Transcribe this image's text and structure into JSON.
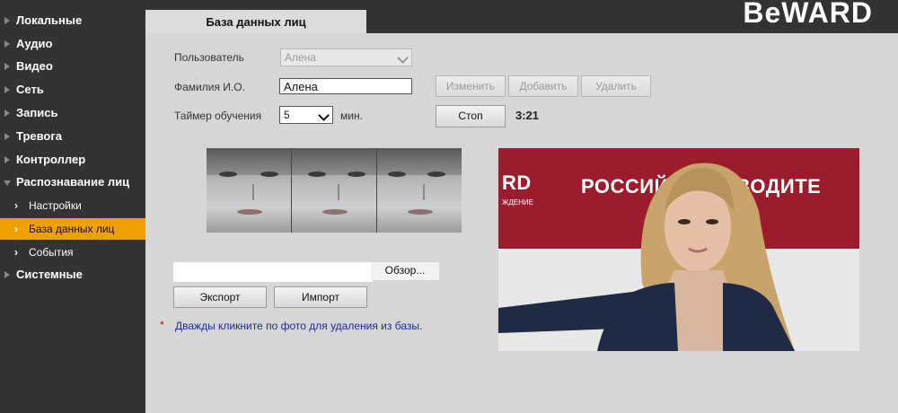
{
  "logo": "BeWARD",
  "sidebar": {
    "items": [
      {
        "label": "Локальные"
      },
      {
        "label": "Аудио"
      },
      {
        "label": "Видео"
      },
      {
        "label": "Сеть"
      },
      {
        "label": "Запись"
      },
      {
        "label": "Тревога"
      },
      {
        "label": "Контроллер"
      },
      {
        "label": "Распознавание лиц"
      },
      {
        "label": "Системные"
      }
    ],
    "subitems": [
      {
        "label": "Настройки"
      },
      {
        "label": "База данных лиц"
      },
      {
        "label": "События"
      }
    ]
  },
  "tab": {
    "title": "База данных лиц"
  },
  "form": {
    "user_label": "Пользователь",
    "user_value": "Алена",
    "name_label": "Фамилия И.О.",
    "name_value": "Алена",
    "timer_label": "Таймер обучения",
    "timer_value": "5",
    "timer_unit": "мин.",
    "countdown": "3:21"
  },
  "buttons": {
    "edit": "Изменить",
    "add": "Добавить",
    "delete": "Удалить",
    "stop": "Стоп",
    "browse": "Обзор...",
    "export": "Экспорт",
    "import": "Импорт"
  },
  "preview": {
    "banner_left": "RD",
    "banner_left_small": "ЖДЕНИЕ",
    "banner_right": "РОССИЙ    ОИЗВОДИТЕ"
  },
  "note": {
    "star": "*",
    "text": "Дважды кликните по фото для удаления из базы."
  },
  "colors": {
    "active_item": "#f0a000",
    "sidebar_bg": "#333333",
    "content_bg": "#d6d6d6",
    "banner": "#9b1c2c",
    "note": "#1a2a9a"
  }
}
